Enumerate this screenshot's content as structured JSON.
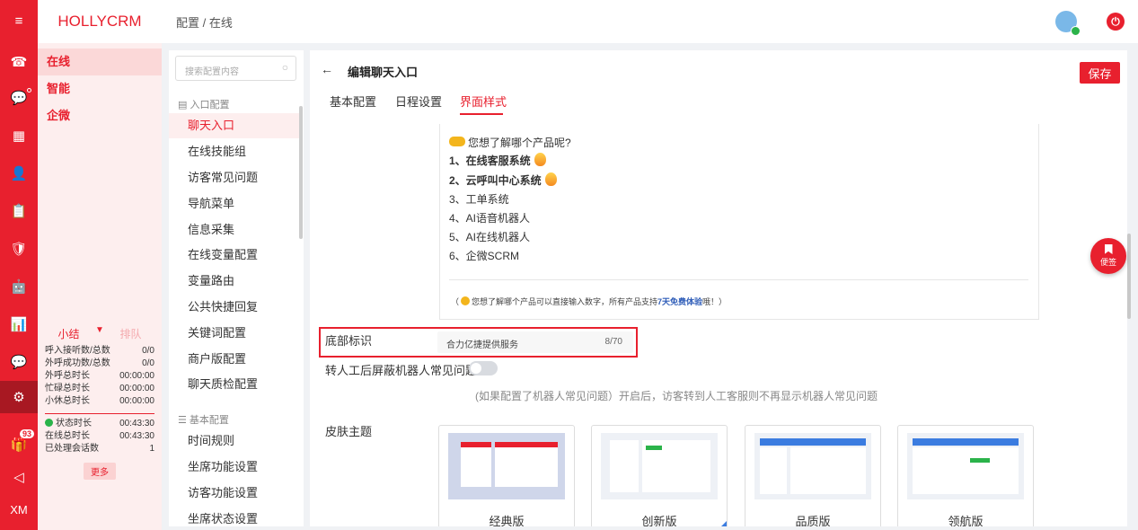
{
  "rail": {
    "items": [
      {
        "icon": "menu-icon",
        "glyph": "≡"
      },
      {
        "icon": "phone-icon",
        "glyph": "☎"
      },
      {
        "icon": "chat-icon",
        "glyph": "💬"
      },
      {
        "icon": "grid-icon",
        "glyph": "▦"
      },
      {
        "icon": "user-icon",
        "glyph": "👤"
      },
      {
        "icon": "clipboard-icon",
        "glyph": "📋"
      },
      {
        "icon": "shield-icon",
        "glyph": "🛡"
      },
      {
        "icon": "robot-icon",
        "glyph": "🤖"
      },
      {
        "icon": "chart-icon",
        "glyph": "📊"
      },
      {
        "icon": "message-icon",
        "glyph": "💬"
      },
      {
        "icon": "gear-icon",
        "glyph": "⚙"
      },
      {
        "icon": "gift-icon",
        "glyph": "🎁"
      },
      {
        "icon": "megaphone-icon",
        "glyph": "◁"
      }
    ],
    "badge": "93",
    "footer": "XM"
  },
  "sidebar": {
    "brand": "HOLLYCRM",
    "items": [
      "在线",
      "智能",
      "企微"
    ]
  },
  "stats": {
    "tab_active": "小结",
    "tab_inactive": "排队",
    "rows": [
      {
        "label": "呼入接听数/总数",
        "value": "0/0"
      },
      {
        "label": "外呼成功数/总数",
        "value": "0/0"
      },
      {
        "label": "外呼总时长",
        "value": "00:00:00"
      },
      {
        "label": "忙碌总时长",
        "value": "00:00:00"
      },
      {
        "label": "小休总时长",
        "value": "00:00:00"
      }
    ],
    "rows2": [
      {
        "label": "状态时长",
        "value": "00:43:30"
      },
      {
        "label": "在线总时长",
        "value": "00:43:30"
      },
      {
        "label": "已处理会话数",
        "value": "1"
      }
    ],
    "more": "更多"
  },
  "header": {
    "breadcrumb": "配置 / 在线"
  },
  "config": {
    "search_placeholder": "搜索配置内容",
    "group1": "入口配置",
    "items1": [
      "聊天入口",
      "在线技能组",
      "访客常见问题",
      "导航菜单",
      "信息采集",
      "在线变量配置",
      "变量路由",
      "公共快捷回复",
      "关键词配置",
      "商户版配置",
      "聊天质检配置"
    ],
    "group2": "基本配置",
    "items2": [
      "时间规则",
      "坐席功能设置",
      "访客功能设置",
      "坐席状态设置"
    ]
  },
  "main": {
    "back": "←",
    "title": "编辑聊天入口",
    "save": "保存",
    "tabs": [
      "基本配置",
      "日程设置",
      "界面样式"
    ],
    "preview": {
      "q": "您想了解哪个产品呢?",
      "l1": "1、在线客服系统",
      "l2": "2、云呼叫中心系统",
      "l3": "3、工单系统",
      "l4": "4、AI语音机器人",
      "l5": "5、AI在线机器人",
      "l6": "6、企微SCRM",
      "hint_a": "（",
      "hint_b": "您想了解哪个产品可以直接输入数字，所有产品支持",
      "hint_em": "7天免费体验",
      "hint_c": "哦！）"
    },
    "footer_label": "底部标识",
    "footer_value": "合力亿捷提供服务",
    "footer_count": "8/70",
    "toggle_label": "转人工后屏蔽机器人常见问题",
    "toggle_desc": "(如果配置了机器人常见问题）开启后，访客转到人工客服则不再显示机器人常见问题",
    "skin_label": "皮肤主题",
    "skins": [
      "经典版",
      "创新版",
      "品质版",
      "领航版"
    ]
  },
  "float": {
    "bookmark": "便签"
  }
}
